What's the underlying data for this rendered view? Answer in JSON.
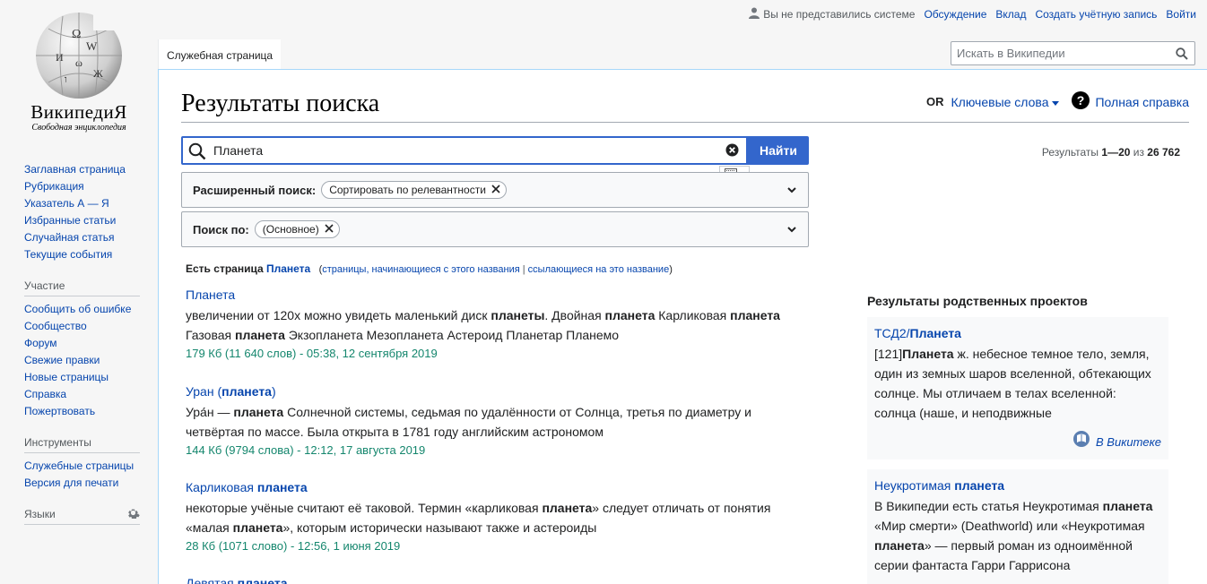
{
  "personal": {
    "anon_text": "Вы не представились системе",
    "talk": "Обсуждение",
    "contributions": "Вклад",
    "create_account": "Создать учётную запись",
    "login": "Войти"
  },
  "logo": {
    "wordmark": "ВикипедиЯ",
    "tagline": "Свободная энциклопедия"
  },
  "sidebar": {
    "navigation": [
      {
        "label": "Заглавная страница"
      },
      {
        "label": "Рубрикация"
      },
      {
        "label": "Указатель А — Я"
      },
      {
        "label": "Избранные статьи"
      },
      {
        "label": "Случайная статья"
      },
      {
        "label": "Текущие события"
      }
    ],
    "participation": {
      "title": "Участие",
      "items": [
        {
          "label": "Сообщить об ошибке"
        },
        {
          "label": "Сообщество"
        },
        {
          "label": "Форум"
        },
        {
          "label": "Свежие правки"
        },
        {
          "label": "Новые страницы"
        },
        {
          "label": "Справка"
        },
        {
          "label": "Пожертвовать"
        }
      ]
    },
    "tools": {
      "title": "Инструменты",
      "items": [
        {
          "label": "Служебные страницы"
        },
        {
          "label": "Версия для печати"
        }
      ]
    },
    "languages": {
      "title": "Языки"
    }
  },
  "tabs": {
    "special": "Служебная страница"
  },
  "header_search": {
    "placeholder": "Искать в Википедии"
  },
  "page": {
    "title": "Результаты поиска",
    "indicators": {
      "or": "OR",
      "keywords": "Ключевые слова",
      "help": "Полная справка"
    },
    "search": {
      "value": "Планета",
      "button": "Найти"
    },
    "results_count": {
      "prefix": "Результаты ",
      "range": "1—20",
      "mid": " из ",
      "total": "26 762"
    },
    "advanced": {
      "label": "Расширенный поиск:",
      "chip": "Сортировать по релевантности"
    },
    "namespaces": {
      "label": "Поиск по:",
      "chip": "(Основное)"
    },
    "did_you": {
      "prefix": "Есть страница ",
      "page": "Планета",
      "open": "(",
      "prefix_link": "страницы, начинающиеся с этого названия",
      "sep": " | ",
      "links_link": "ссылающиеся на это название",
      "close": ")"
    }
  },
  "results": [
    {
      "title": "Планета",
      "snippet": "увеличении от 120x можно увидеть маленький диск <b>планеты</b>. Двойная <b>планета</b> Карликовая <b>планета</b> Газовая <b>планета</b> Экзопланета Мезопланета Астероид Планетар Планемо",
      "meta": "179 Кб (11 640 слов) - 05:38, 12 сентября 2019"
    },
    {
      "title": "Уран (<b>планета</b>)",
      "snippet": "Ура́н — <b>планета</b> Солнечной системы, седьмая по удалённости от Солнца, третья по диаметру и четвёртая по массе. Была открыта в 1781 году английским астрономом",
      "meta": "144 Кб (9794 слова) - 12:12, 17 августа 2019"
    },
    {
      "title": "Карликовая <b>планета</b>",
      "snippet": "некоторые учёные считают её таковой. Термин «карликовая <b>планета</b>» следует отличать от понятия «малая <b>планета</b>», которым исторически называют также и астероиды",
      "meta": "28 Кб (1071 слово) - 12:56, 1 июня 2019"
    },
    {
      "title": "Девятая <b>планета</b>",
      "snippet": "",
      "meta": ""
    }
  ],
  "sister": {
    "heading": "Результаты родственных проектов",
    "items": [
      {
        "title": "ТСД2/<b>Планета</b>",
        "text": "[121]<b>Планета</b> ж. небесное темное тело, земля, один из земных шаров вселенной, обтекающих солнце. Мы отличаем в телах вселенной: солнца (наше, и неподвижные",
        "source": "В Викитеке"
      },
      {
        "title": "Неукротимая <b>планета</b>",
        "text": "В Википедии есть статья Неукротимая <b>планета</b> «Мир смерти» (Deathworld) или «Неукротимая <b>планета</b>» — первый роман из одноимённой серии фантаста Гарри Гаррисона",
        "source": ""
      }
    ]
  },
  "colors": {
    "link": "#0645ad",
    "accent": "#3366cc",
    "meta_green": "#14866d",
    "sidebar_bg": "#f6f6f6"
  }
}
